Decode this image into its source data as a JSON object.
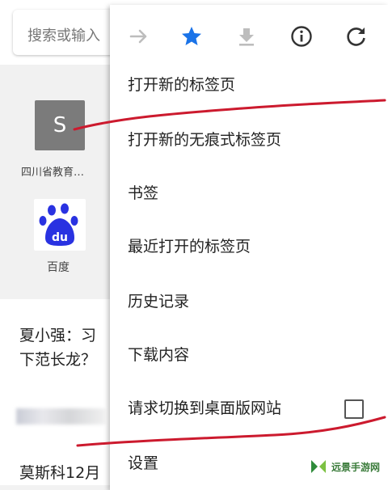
{
  "background": {
    "search_placeholder": "搜索或输入",
    "tiles": [
      {
        "letter": "S",
        "label": "四川省教育…"
      },
      {
        "label": "百度",
        "logo_text": "du"
      }
    ],
    "news": [
      {
        "title_line1": "夏小强：习",
        "title_line2": "下范长龙？"
      },
      {
        "title": "莫斯科12月"
      }
    ]
  },
  "menu": {
    "toolbar_icons": [
      "forward-icon",
      "bookmark-star-icon",
      "download-icon",
      "info-icon",
      "refresh-icon"
    ],
    "items": [
      {
        "label": "打开新的标签页"
      },
      {
        "label": "打开新的无痕式标签页"
      },
      {
        "label": "书签"
      },
      {
        "label": "最近打开的标签页"
      },
      {
        "label": "历史记录"
      },
      {
        "label": "下载内容"
      },
      {
        "label": "请求切换到桌面版网站",
        "checked": false
      },
      {
        "label": "设置"
      }
    ]
  },
  "colors": {
    "accent": "#1a73e8",
    "annotation": "#cc1a2e",
    "tile_gray": "#7b7b7b",
    "baidu_blue": "#2932e1"
  },
  "watermark": "远景手游网"
}
